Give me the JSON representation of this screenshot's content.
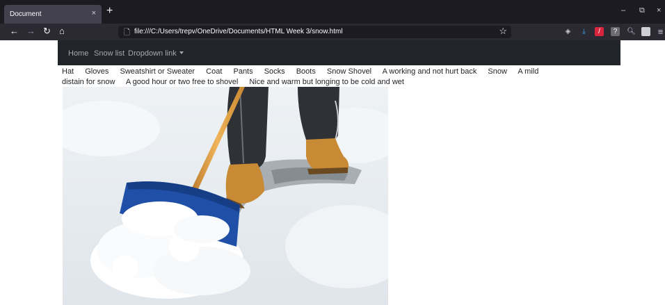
{
  "browser": {
    "tab": {
      "title": "Document",
      "close": "×"
    },
    "new_tab": "+",
    "window_controls": [
      "–",
      "⧉",
      "×"
    ],
    "nav": {
      "back": "←",
      "forward": "→",
      "reload": "↻",
      "home": "⌂"
    },
    "url": "file:///C:/Users/trepv/OneDrive/Documents/HTML Week 3/snow.html",
    "bookmark": "☆",
    "menu": "≡"
  },
  "site_nav": {
    "home": "Home",
    "snow_list": "Snow list",
    "dropdown": "Dropdown link"
  },
  "snow_items": [
    "Hat",
    "Gloves",
    "Sweatshirt or Sweater",
    "Coat",
    "Pants",
    "Socks",
    "Boots",
    "Snow Shovel",
    "A working and not hurt back",
    "Snow",
    "A mild distain for snow",
    "A good hour or two free to shovel",
    "Nice and warm but longing to be cold and wet"
  ],
  "colors": {
    "navbar_bg": "#212529",
    "navbar_link": "#a6a9ad",
    "shovel_blue": "#1f4fa6",
    "handle": "#e0a13a",
    "boot": "#c98a35"
  }
}
